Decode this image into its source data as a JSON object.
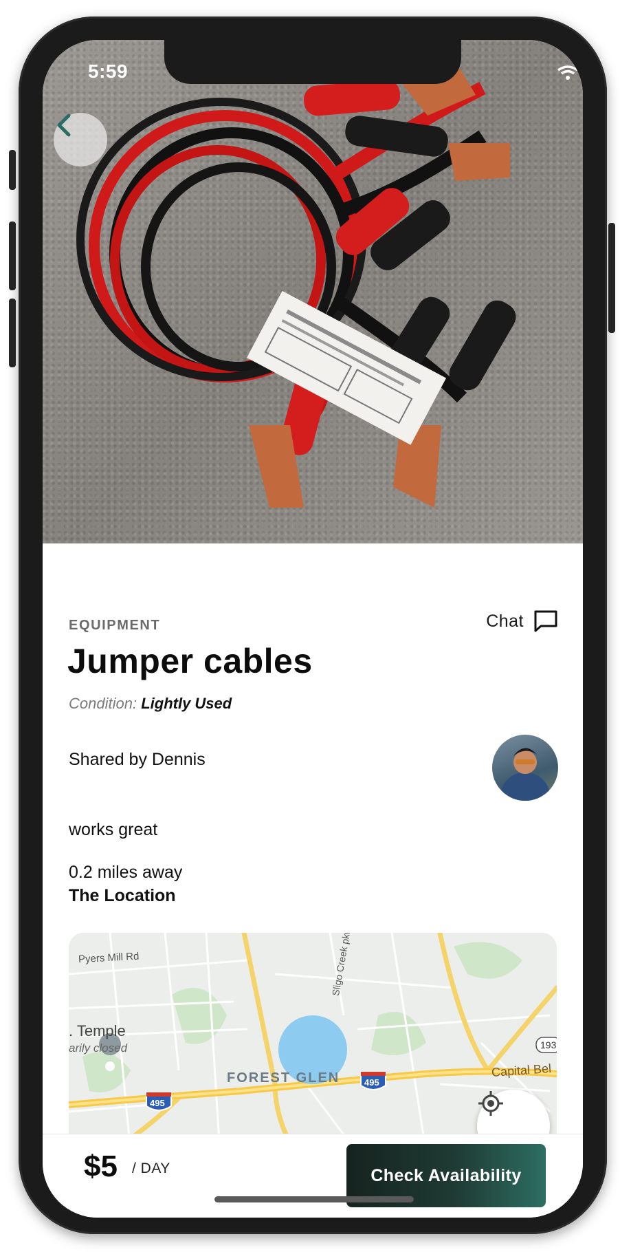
{
  "status_bar": {
    "time": "5:59"
  },
  "item": {
    "category": "EQUIPMENT",
    "title": "Jumper cables",
    "condition_label": "Condition:",
    "condition_value": "Lightly Used",
    "shared_by": "Shared by Dennis",
    "description": "works great",
    "distance": "0.2 miles away",
    "location_title": "The Location"
  },
  "chat": {
    "label": "Chat"
  },
  "map": {
    "labels": {
      "pyers_mill": "Pyers Mill Rd",
      "sligo_creek": "Sligo Creek pkwy",
      "temple": ". Temple",
      "temple_status": "arily closed",
      "forest_glen": "FOREST GLEN",
      "route_495_a": "495",
      "route_495_b": "495",
      "route_193": "193",
      "capital_beltway": "Capital Bel"
    }
  },
  "booking": {
    "price": "$5",
    "unit": "/ DAY",
    "cta_label": "Check Availability"
  },
  "colors": {
    "accent_dark": "#16231f",
    "accent_teal": "#2d6e62",
    "back_icon": "#2c6b66"
  }
}
